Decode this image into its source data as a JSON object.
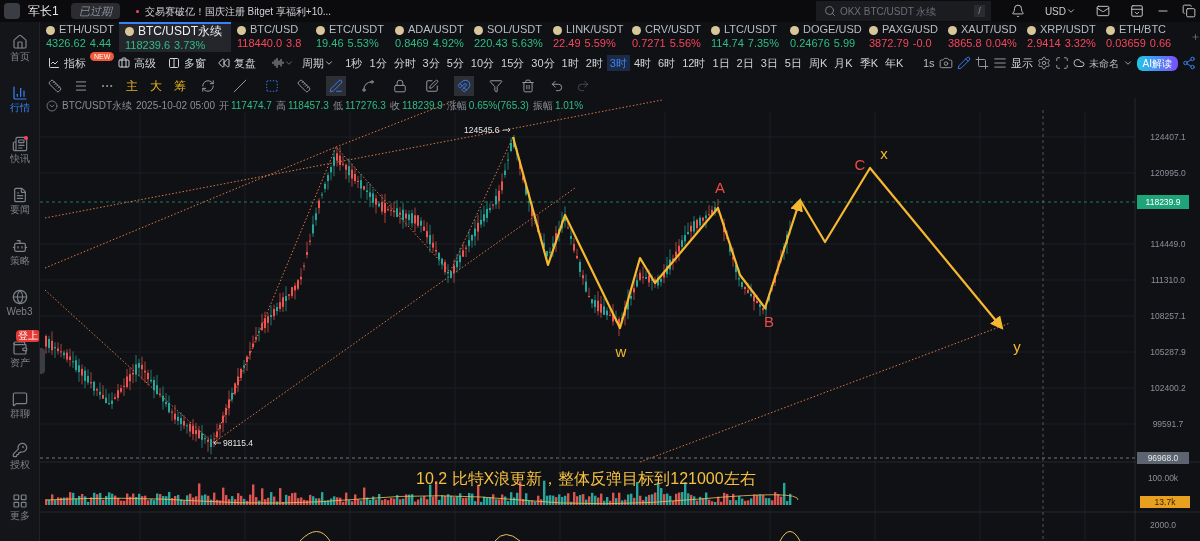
{
  "top_bar": {
    "username": "军长1",
    "membership": "已过期",
    "news": "交易赛破亿！国庆注册 Bitget 享福利+10...",
    "search": {
      "placeholder": "OKX BTC/USDT 永续",
      "shortcut": "/"
    },
    "currency": "USD"
  },
  "sidebar": [
    {
      "label": "首页",
      "selected": false
    },
    {
      "label": "行情",
      "selected": true
    },
    {
      "label": "快讯",
      "selected": false,
      "dot": true
    },
    {
      "label": "要闻",
      "selected": false
    },
    {
      "label": "策略",
      "selected": false
    },
    {
      "label": "Web3",
      "selected": false
    },
    {
      "label": "资产",
      "selected": false,
      "badge": "登上"
    },
    {
      "label": "群聊",
      "selected": false
    },
    {
      "label": "授权",
      "selected": false
    },
    {
      "label": "更多",
      "selected": false
    }
  ],
  "tickers": [
    {
      "name": "ETH/USDT",
      "price": "4326.62",
      "change": "4.44",
      "color": "#2ebd85",
      "selected": false
    },
    {
      "name": "BTC/USDT永续",
      "price": "118239.6",
      "change": "3.73%",
      "color": "#2ebd85",
      "selected": true
    },
    {
      "name": "BTC/USD",
      "price": "118440.0",
      "change": "3.8",
      "color": "#f6465d",
      "selected": false
    },
    {
      "name": "ETC/USDT",
      "price": "19.46",
      "change": "5.53%",
      "color": "#2ebd85",
      "selected": false
    },
    {
      "name": "ADA/USDT",
      "price": "0.8469",
      "change": "4.92%",
      "color": "#2ebd85",
      "selected": false
    },
    {
      "name": "SOL/USDT",
      "price": "220.43",
      "change": "5.63%",
      "color": "#2ebd85",
      "selected": false
    },
    {
      "name": "LINK/USDT",
      "price": "22.49",
      "change": "5.59%",
      "color": "#f6465d",
      "selected": false
    },
    {
      "name": "CRV/USDT",
      "price": "0.7271",
      "change": "5.56%",
      "color": "#f6465d",
      "selected": false
    },
    {
      "name": "LTC/USDT",
      "price": "114.74",
      "change": "7.35%",
      "color": "#2ebd85",
      "selected": false
    },
    {
      "name": "DOGE/USD",
      "price": "0.24676",
      "change": "5.99",
      "color": "#2ebd85",
      "selected": false
    },
    {
      "name": "PAXG/USD",
      "price": "3872.79",
      "change": "-0.0",
      "color": "#f6465d",
      "selected": false
    },
    {
      "name": "XAUT/USD",
      "price": "3865.8",
      "change": "0.04%",
      "color": "#f6465d",
      "selected": false
    },
    {
      "name": "XRP/USDT",
      "price": "2.9414",
      "change": "3.32%",
      "color": "#f6465d",
      "selected": false
    },
    {
      "name": "ETH/BTC",
      "price": "0.03659",
      "change": "0.66",
      "color": "#f6465d",
      "selected": false
    }
  ],
  "toolbar": {
    "tools": [
      {
        "label": "指标",
        "badge": "NEW"
      },
      {
        "label": "高级"
      },
      {
        "label": "多窗"
      },
      {
        "label": "复盘"
      }
    ],
    "period_label": "周期",
    "intervals": [
      {
        "label": "1秒",
        "selected": false
      },
      {
        "label": "1分",
        "selected": false
      },
      {
        "label": "分时",
        "selected": false
      },
      {
        "label": "3分",
        "selected": false
      },
      {
        "label": "5分",
        "selected": false
      },
      {
        "label": "10分",
        "selected": false
      },
      {
        "label": "15分",
        "selected": false
      },
      {
        "label": "30分",
        "selected": false
      },
      {
        "label": "1时",
        "selected": false
      },
      {
        "label": "2时",
        "selected": false
      },
      {
        "label": "3时",
        "selected": true
      },
      {
        "label": "4时",
        "selected": false
      },
      {
        "label": "6时",
        "selected": false
      },
      {
        "label": "12时",
        "selected": false
      },
      {
        "label": "1日",
        "selected": false
      },
      {
        "label": "2日",
        "selected": false
      },
      {
        "label": "3日",
        "selected": false
      },
      {
        "label": "5日",
        "selected": false
      },
      {
        "label": "周K",
        "selected": false
      },
      {
        "label": "月K",
        "selected": false
      },
      {
        "label": "季K",
        "selected": false
      },
      {
        "label": "年K",
        "selected": false
      }
    ],
    "refresh": "1s",
    "display": "显示",
    "layout_name": "未命名",
    "ai_button": "AI解读"
  },
  "drawing_bar": {
    "indicators": [
      "主",
      "大",
      "筹"
    ],
    "tools": [
      {
        "selected": false
      },
      {
        "selected": false
      },
      {
        "selected": false
      },
      {
        "selected": false
      },
      {
        "selected": true
      },
      {
        "selected": false
      },
      {
        "selected": false
      },
      {
        "selected": false
      },
      {
        "selected": true
      },
      {
        "selected": false
      },
      {
        "selected": false
      }
    ]
  },
  "ohlc": {
    "symbol": "BTC/USDT永续",
    "time": "2025-10-02 05:00",
    "fields": [
      {
        "label": "开",
        "value": "117474.7"
      },
      {
        "label": "高",
        "value": "118457.3"
      },
      {
        "label": "低",
        "value": "117276.3"
      },
      {
        "label": "收",
        "value": "118239.9"
      },
      {
        "label": "涨幅",
        "value": "0.65%(765.3)"
      },
      {
        "label": "振幅",
        "value": "1.01%"
      }
    ]
  },
  "chart": {
    "price_axis": [
      "124407.1",
      "120995.0",
      "114449.0",
      "111310.0",
      "108257.1",
      "105287.9",
      "102400.2",
      "99591.7"
    ],
    "last_price": "118239.9",
    "cursor_price": "96968.0",
    "volume_axis": "100.00k",
    "volume_last": "13.7k",
    "lower_axis": "2000.0",
    "high_mark": "124545.6",
    "low_mark": "98115.4",
    "wave_labels": [
      {
        "text": "A",
        "color": "#f04848"
      },
      {
        "text": "B",
        "color": "#f04848"
      },
      {
        "text": "C",
        "color": "#f04848"
      },
      {
        "text": "x",
        "color": "#f5b82e"
      },
      {
        "text": "w",
        "color": "#f5b82e"
      },
      {
        "text": "y",
        "color": "#f5b82e"
      }
    ],
    "caption": "10.2 比特X浪更新，整体反弹目标到121000左右"
  }
}
